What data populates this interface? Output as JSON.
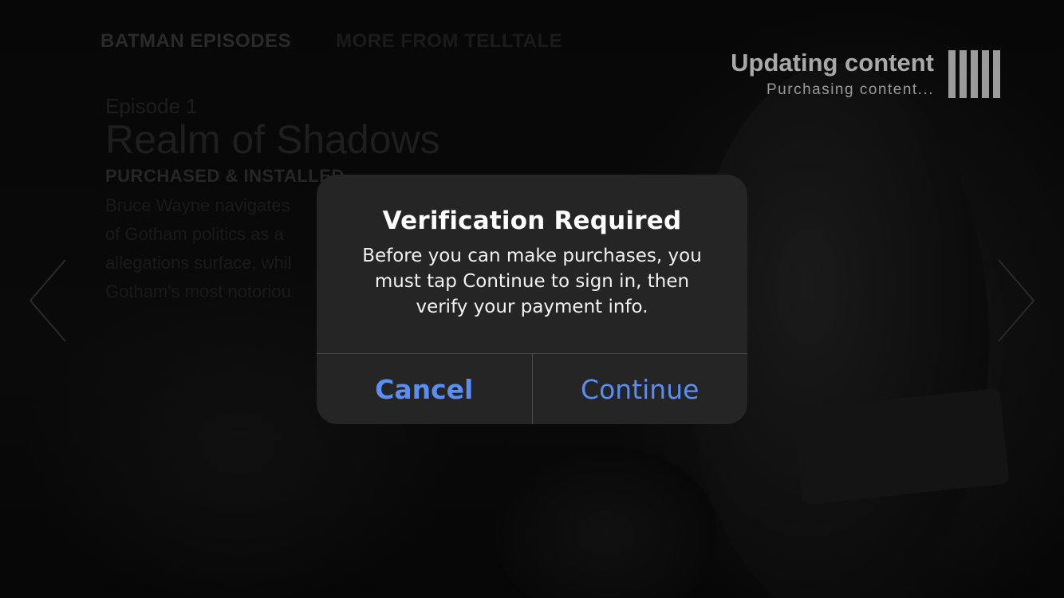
{
  "tabs": {
    "batman": "BATMAN EPISODES",
    "more": "MORE FROM TELLTALE"
  },
  "status": {
    "title": "Updating content",
    "subtitle": "Purchasing content..."
  },
  "episode": {
    "number": "Episode 1",
    "title": "Realm of Shadows",
    "state": "PURCHASED & INSTALLED",
    "description_lines": [
      "Bruce Wayne navigates",
      "of Gotham politics as a",
      "allegations surface, whil",
      "Gotham's most notoriou"
    ]
  },
  "dialog": {
    "title": "Verification Required",
    "message": "Before you can make purchases, you must tap Continue to sign in, then verify your payment info.",
    "cancel_label": "Cancel",
    "continue_label": "Continue"
  },
  "icons": {
    "left": "chevron-left-icon",
    "right": "chevron-right-icon"
  },
  "colors": {
    "dialog_bg": "#252525",
    "button_text": "#5b8ef2"
  }
}
